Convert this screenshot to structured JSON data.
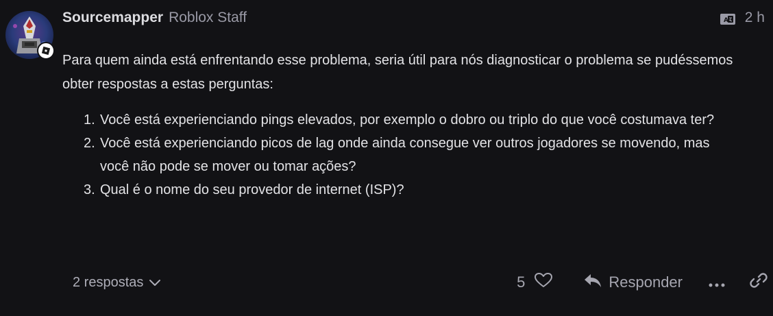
{
  "post": {
    "author": {
      "username": "Sourcemapper",
      "title": "Roblox Staff"
    },
    "time": "2 h",
    "body": "Para quem ainda está enfrentando esse problema, seria útil para nós diagnosticar o problema se pudéssemos obter respostas a estas perguntas:",
    "questions": [
      {
        "num": "1.",
        "text": "Você está experienciando pings elevados, por exemplo o dobro ou triplo do que você costumava ter?"
      },
      {
        "num": "2.",
        "text": "Você está experienciando picos de lag onde ainda consegue ver outros jogadores se movendo, mas você não pode se mover ou tomar ações?"
      },
      {
        "num": "3.",
        "text": "Qual é o nome do seu provedor de internet (ISP)?"
      }
    ]
  },
  "footer": {
    "replies_label": "2 respostas",
    "likes": "5",
    "reply_label": "Responder"
  },
  "icons": {
    "translate": "translate-icon",
    "chevron": "chevron-down-icon",
    "heart": "heart-icon",
    "reply": "reply-icon",
    "more": "more-icon",
    "link": "link-icon"
  },
  "colors": {
    "background": "#121215",
    "text": "#e3e3e6",
    "muted": "#9a9aa6"
  }
}
